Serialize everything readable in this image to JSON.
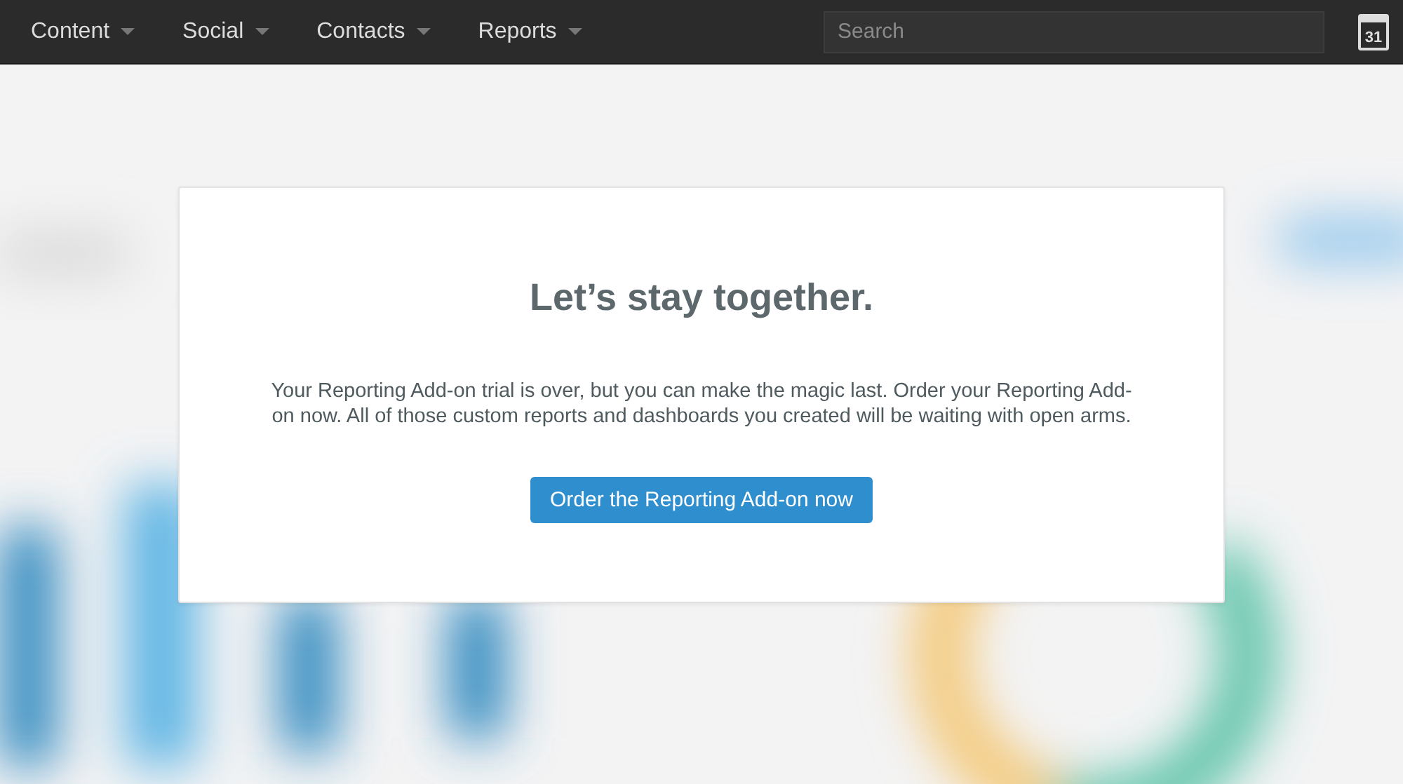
{
  "nav": {
    "menus": [
      {
        "label": "Content"
      },
      {
        "label": "Social"
      },
      {
        "label": "Contacts"
      },
      {
        "label": "Reports"
      }
    ],
    "search": {
      "placeholder": "Search"
    },
    "calendar_day": "31"
  },
  "modal": {
    "title": "Let’s stay together.",
    "message": "Your Reporting Add-on trial is over, but you can make the magic last. Order your Reporting Add-on now. All of those custom reports and dashboards you created will be waiting with open arms.",
    "button": "Order the Reporting Add-on now"
  }
}
